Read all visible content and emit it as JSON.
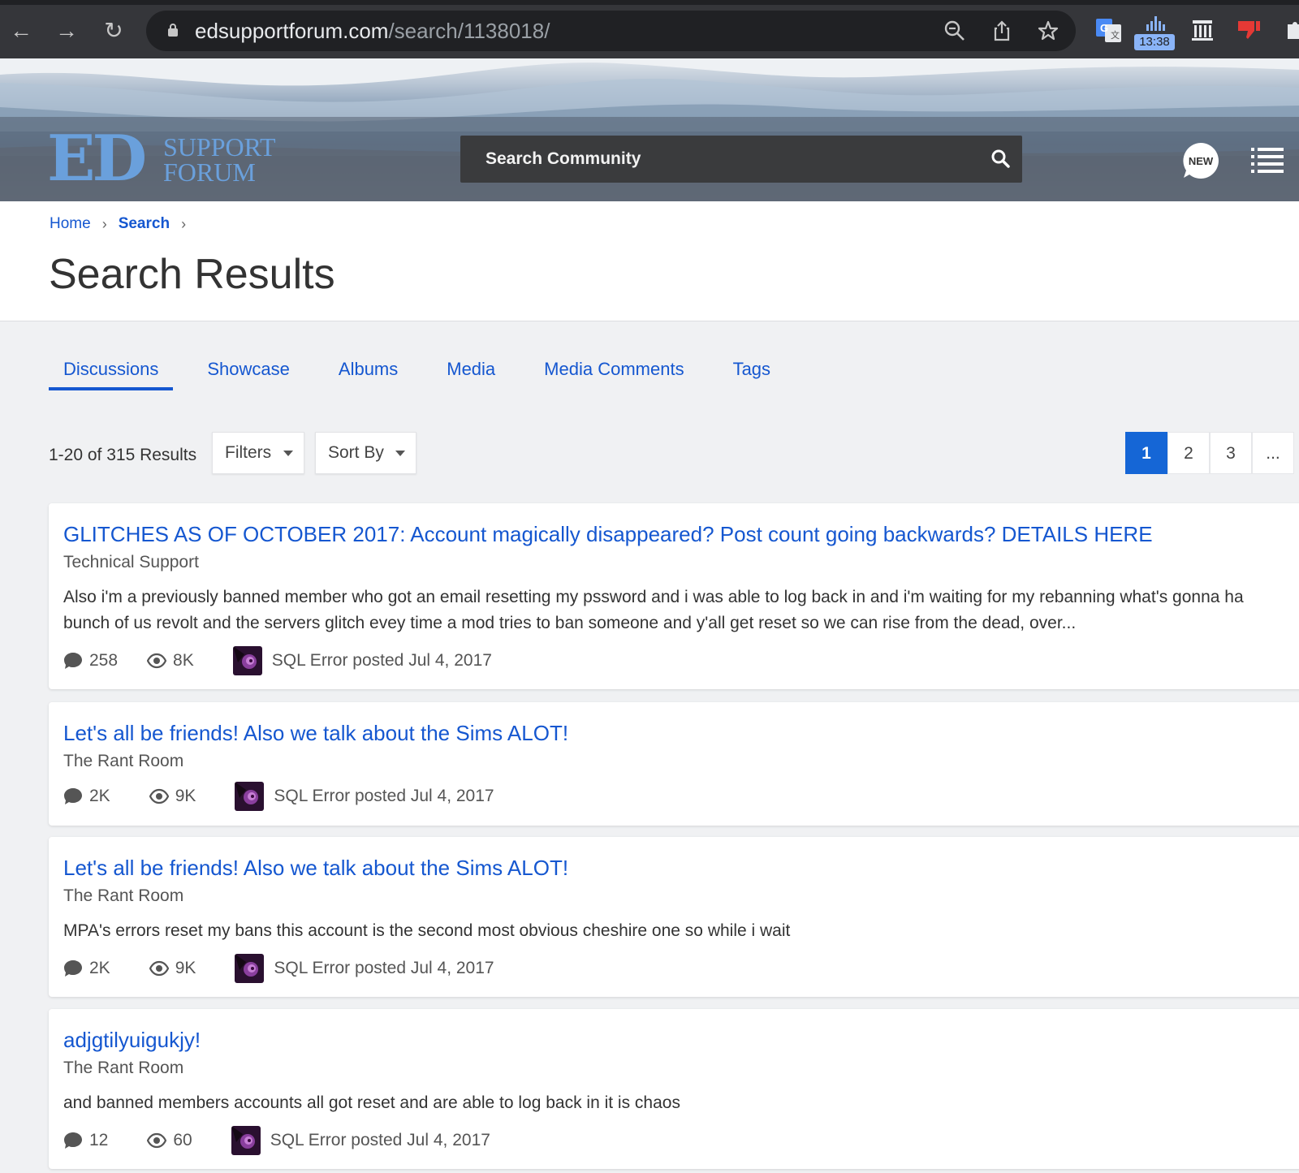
{
  "browser": {
    "url_host": "edsupportforum.com",
    "url_path": "/search/1138018/",
    "clock": "13:38",
    "back_icon": "←",
    "forward_icon": "→",
    "reload_icon": "↻"
  },
  "header": {
    "logo_main": "ED",
    "logo_line1": "SUPPORT",
    "logo_line2": "FORUM",
    "search_placeholder": "Search Community",
    "new_label": "NEW"
  },
  "breadcrumb": {
    "home": "Home",
    "current": "Search"
  },
  "page_title": "Search Results",
  "tabs": [
    {
      "label": "Discussions",
      "active": true
    },
    {
      "label": "Showcase",
      "active": false
    },
    {
      "label": "Albums",
      "active": false
    },
    {
      "label": "Media",
      "active": false
    },
    {
      "label": "Media Comments",
      "active": false
    },
    {
      "label": "Tags",
      "active": false
    }
  ],
  "toolbar": {
    "result_count": "1-20 of 315 Results",
    "filters_label": "Filters",
    "sort_label": "Sort By"
  },
  "pagination": [
    "1",
    "2",
    "3",
    "..."
  ],
  "results": [
    {
      "title": "GLITCHES AS OF OCTOBER 2017: Account magically disappeared? Post count going backwards? DETAILS HERE",
      "forum": "Technical Support",
      "snippet_line1": "Also i'm a previously banned member who got an email resetting my pssword and i was able to log back in and i'm waiting for my rebanning what's gonna ha",
      "snippet_line2": "bunch of us revolt and the servers glitch evey time a mod tries to ban someone and y'all get reset so we can rise from the dead, over...",
      "replies": "258",
      "views": "8K",
      "byline": "SQL Error posted Jul 4, 2017"
    },
    {
      "title": "Let's all be friends! Also we talk about the Sims ALOT!",
      "forum": "The Rant Room",
      "snippet_line1": "",
      "snippet_line2": "",
      "replies": "2K",
      "views": "9K",
      "byline": "SQL Error posted Jul 4, 2017"
    },
    {
      "title": "Let's all be friends! Also we talk about the Sims ALOT!",
      "forum": "The Rant Room",
      "snippet_line1": "MPA's errors reset my bans this account is the second most obvious cheshire one so while i wait",
      "snippet_line2": "",
      "replies": "2K",
      "views": "9K",
      "byline": "SQL Error posted Jul 4, 2017"
    },
    {
      "title": "adjgtilyuigukjy!",
      "forum": "The Rant Room",
      "snippet_line1": "and banned members accounts all got reset and are able to log back in it is chaos",
      "snippet_line2": "",
      "replies": "12",
      "views": "60",
      "byline": "SQL Error posted Jul 4, 2017"
    }
  ]
}
